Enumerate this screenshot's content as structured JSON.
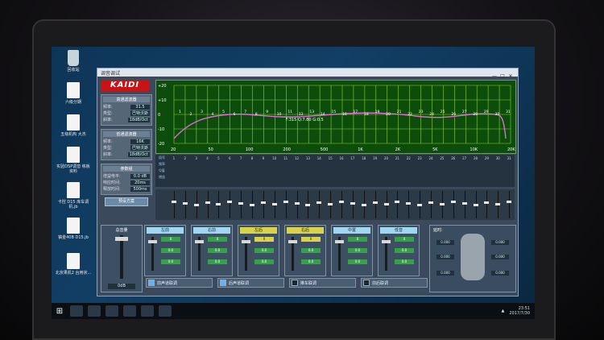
{
  "desktop_icons": [
    {
      "label": "回收站",
      "type": "bin"
    },
    {
      "label": "六级分期",
      "type": "file"
    },
    {
      "label": "五级机构 大杰",
      "type": "file"
    },
    {
      "label": "实验DSP调音 练板资料",
      "type": "file"
    },
    {
      "label": "卡控 D15 库车调机.jb",
      "type": "file"
    },
    {
      "label": "镐金40B D15.jb",
      "type": "file"
    },
    {
      "label": "北京果机2 台用状...",
      "type": "file"
    }
  ],
  "app": {
    "title": "调音调试",
    "window_controls": [
      "—",
      "□",
      "✕"
    ],
    "logo": "KAIDI",
    "high_pass": {
      "header": "高通滤波器",
      "rows": [
        {
          "label": "频率:",
          "value": "31.5"
        },
        {
          "label": "类型:",
          "value": "巴特沃斯"
        },
        {
          "label": "斜率:",
          "value": "18dB/Oct"
        }
      ]
    },
    "low_pass": {
      "header": "低通滤波器",
      "rows": [
        {
          "label": "频率:",
          "value": "16K"
        },
        {
          "label": "类型:",
          "value": "巴特沃斯"
        },
        {
          "label": "斜率:",
          "value": "18dB/Oct"
        }
      ]
    },
    "params": {
      "header": "参数组",
      "rows": [
        {
          "label": "增益电平:",
          "value": "0.0 dB"
        },
        {
          "label": "响应时间:",
          "value": "20ms"
        },
        {
          "label": "释放时间:",
          "value": "500ms"
        }
      ]
    },
    "preset_button": "预设方案",
    "graph": {
      "y_ticks": [
        "+20",
        "+10",
        "0",
        "-10",
        "-20"
      ],
      "x_ticks": [
        "20",
        "50",
        "100",
        "200",
        "500",
        "1K",
        "2K",
        "5K",
        "10K",
        "20KHz"
      ],
      "band_numbers": [
        "1",
        "2",
        "3",
        "4",
        "5",
        "6",
        "7",
        "8",
        "9",
        "10",
        "11",
        "12",
        "13",
        "14",
        "15",
        "16",
        "17",
        "18",
        "19",
        "20",
        "21",
        "22",
        "23",
        "24",
        "25",
        "26",
        "27",
        "28",
        "29",
        "30",
        "31"
      ],
      "readout": "F:315 Q:7.80 G:0.5"
    },
    "eq_table": {
      "row_labels": [
        "段号",
        "频率",
        "Q值",
        "增益"
      ],
      "columns": [
        "1",
        "2",
        "3",
        "4",
        "5",
        "6",
        "7",
        "8",
        "9",
        "10",
        "11",
        "12",
        "13",
        "14",
        "15",
        "16",
        "17",
        "18",
        "19",
        "20",
        "21",
        "22",
        "23",
        "24",
        "25",
        "26",
        "27",
        "28",
        "29",
        "30",
        "31"
      ]
    },
    "master": {
      "label": "总音量",
      "value": "0dB"
    },
    "channels": [
      {
        "name": "左前",
        "values": [
          "0",
          "0.0",
          "0.0"
        ],
        "active": false
      },
      {
        "name": "右前",
        "values": [
          "0",
          "0.0",
          "0.0"
        ],
        "active": false
      },
      {
        "name": "左后",
        "values": [
          "0",
          "0.0",
          "0.0"
        ],
        "active": true
      },
      {
        "name": "右后",
        "values": [
          "0",
          "0.0",
          "0.0"
        ],
        "active": true
      },
      {
        "name": "中置",
        "values": [
          "0",
          "0.0",
          "0.0"
        ],
        "active": false
      },
      {
        "name": "低音",
        "values": [
          "0",
          "0.0",
          "0.0"
        ],
        "active": false
      }
    ],
    "checkboxes": [
      {
        "label": "前声道联调",
        "checked": true
      },
      {
        "label": "后声道联调",
        "checked": true
      },
      {
        "label": "推车联调",
        "checked": false
      },
      {
        "label": "前后联调",
        "checked": false
      }
    ],
    "delay": {
      "label": "延时:",
      "values": [
        "0.000",
        "0.000",
        "0.000",
        "0.000",
        "0.000",
        "0.000"
      ]
    }
  },
  "taskbar": {
    "start": "⊞",
    "clock_time": "23:51",
    "clock_date": "2017/7/30"
  }
}
